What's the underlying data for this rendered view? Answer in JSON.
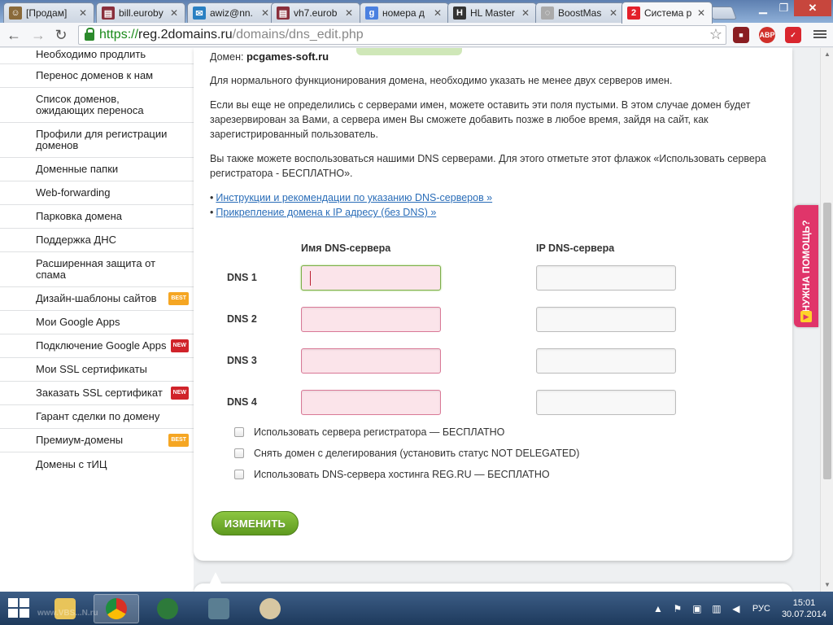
{
  "browser": {
    "tabs": [
      {
        "label": "[Продам]",
        "icon": "user-icon",
        "color": "#8a6a3a"
      },
      {
        "label": "bill.euroby",
        "icon": "books-icon",
        "color": "#8a2f3c"
      },
      {
        "label": "awiz@nn.",
        "icon": "mail-icon",
        "color": "#2a80c2"
      },
      {
        "label": "vh7.eurob",
        "icon": "books-icon",
        "color": "#8a2f3c"
      },
      {
        "label": "номера д",
        "icon": "google-icon",
        "color": "#4a80e0"
      },
      {
        "label": "HL Master",
        "icon": "hl-icon",
        "color": "#333333"
      },
      {
        "label": "BoostMas",
        "icon": "globe-icon",
        "color": "#aaaaaa"
      },
      {
        "label": "Система р",
        "icon": "reg-icon",
        "color": "#e3202a"
      }
    ],
    "address": {
      "scheme": "https://",
      "host": "reg.2domains.ru",
      "path": "/domains/dns_edit.php"
    }
  },
  "sidebar": {
    "items": [
      {
        "label": "Необходимо продлить",
        "badge": ""
      },
      {
        "label": "Перенос доменов к нам",
        "badge": ""
      },
      {
        "label": "Список доменов, ожидающих переноса",
        "badge": ""
      },
      {
        "label": "Профили для регистрации доменов",
        "badge": ""
      },
      {
        "label": "Доменные папки",
        "badge": ""
      },
      {
        "label": "Web-forwarding",
        "badge": ""
      },
      {
        "label": "Парковка домена",
        "badge": ""
      },
      {
        "label": "Поддержка ДНС",
        "badge": ""
      },
      {
        "label": "Расширенная защита от спама",
        "badge": ""
      },
      {
        "label": "Дизайн-шаблоны сайтов",
        "badge": "BEST"
      },
      {
        "label": "Мои Google Apps",
        "badge": ""
      },
      {
        "label": "Подключение Google Apps",
        "badge": "NEW"
      },
      {
        "label": "Мои SSL сертификаты",
        "badge": ""
      },
      {
        "label": "Заказать SSL сертификат",
        "badge": "NEW"
      },
      {
        "label": "Гарант сделки по домену",
        "badge": ""
      },
      {
        "label": "Премиум-домены",
        "badge": "BEST"
      },
      {
        "label": "Домены с тИЦ",
        "badge": ""
      }
    ]
  },
  "main": {
    "domain_label": "Домен:",
    "domain_value": "pcgames-soft.ru",
    "para1": "Для нормального функционирования домена, необходимо указать не менее двух серверов имен.",
    "para2": "Если вы еще не определились с серверами имен, можете оставить эти поля пустыми. В этом случае домен будет зарезервирован за Вами, а сервера имен Вы сможете добавить позже в любое время, зайдя на сайт, как зарегистрированный пользователь.",
    "para3": "Вы также можете воспользоваться нашими DNS серверами. Для этого отметьте этот флажок «Использовать сервера регистратора - БЕСПЛАТНО».",
    "bullet": "•",
    "link1": "Инструкции и рекомендации по указанию DNS-серверов »",
    "link2": "Прикрепление домена к IP адресу (без DNS) »",
    "col_name": "Имя DNS-сервера",
    "col_ip": "IP DNS-сервера",
    "dns_rows": [
      {
        "label": "DNS 1",
        "name": "",
        "ip": ""
      },
      {
        "label": "DNS 2",
        "name": "",
        "ip": ""
      },
      {
        "label": "DNS 3",
        "name": "",
        "ip": ""
      },
      {
        "label": "DNS 4",
        "name": "",
        "ip": ""
      }
    ],
    "checkboxes": [
      {
        "label": "Использовать сервера регистратора — БЕСПЛАТНО",
        "checked": false
      },
      {
        "label": "Снять домен с делегирования (установить статус NOT DELEGATED)",
        "checked": false
      },
      {
        "label": "Использовать DNS-сервера хостинга REG.RU — БЕСПЛАТНО",
        "checked": false
      }
    ],
    "submit_label": "Изменить"
  },
  "help_tab": {
    "label": "НУЖНА ПОМОЩЬ?"
  },
  "taskbar": {
    "apps": [
      "explorer-icon",
      "chrome-icon",
      "network-monitor-icon",
      "app-icon",
      "paint-icon"
    ],
    "language": "РУС",
    "time": "15:01",
    "date": "30.07.2014",
    "watermark": "www.VBS...N.ru"
  },
  "colors": {
    "accent_green": "#6aa82a",
    "link": "#2a6db8",
    "required_field": "#fbe4ea",
    "help_tab": "#e0356a"
  }
}
